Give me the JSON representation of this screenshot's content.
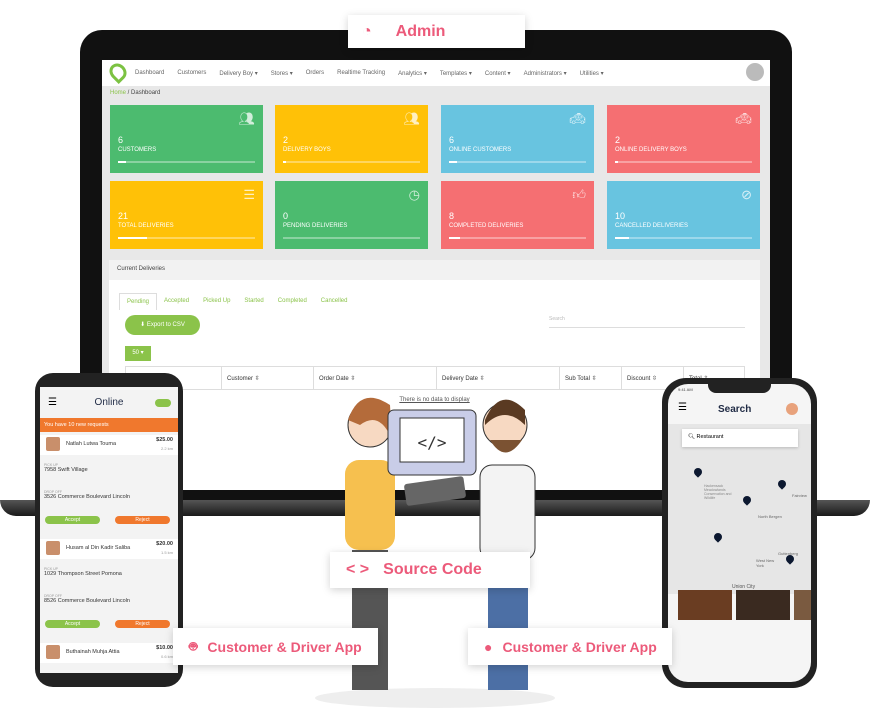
{
  "labels": {
    "admin": "Admin",
    "source_code": "Source Code",
    "android_app": "Customer & Driver App",
    "ios_app": "Customer & Driver App"
  },
  "nav": {
    "items": [
      "Dashboard",
      "Customers",
      "Delivery Boy ▾",
      "Stores ▾",
      "Orders",
      "Realtime Tracking",
      "Analytics ▾",
      "Templates ▾",
      "Content ▾",
      "Administrators ▾",
      "Utilities ▾"
    ]
  },
  "breadcrumb": {
    "home": "Home",
    "sep": " / ",
    "current": "Dashboard"
  },
  "cards": [
    {
      "value": "6",
      "label": "CUSTOMERS",
      "color": "#4cbb6f",
      "icon": "users-icon",
      "progress": 6
    },
    {
      "value": "2",
      "label": "DELIVERY BOYS",
      "color": "#ffc107",
      "icon": "users-icon",
      "progress": 2
    },
    {
      "value": "6",
      "label": "ONLINE CUSTOMERS",
      "color": "#68c4e0",
      "icon": "taxi-icon",
      "progress": 6
    },
    {
      "value": "2",
      "label": "ONLINE DELIVERY BOYS",
      "color": "#f56f72",
      "icon": "taxi-icon",
      "progress": 2
    },
    {
      "value": "21",
      "label": "TOTAL DELIVERIES",
      "color": "#ffc107",
      "icon": "list-icon",
      "progress": 21
    },
    {
      "value": "0",
      "label": "PENDING DELIVERIES",
      "color": "#4cbb6f",
      "icon": "clock-icon",
      "progress": 0
    },
    {
      "value": "8",
      "label": "COMPLETED DELIVERIES",
      "color": "#f56f72",
      "icon": "thumbs-up-icon",
      "progress": 8
    },
    {
      "value": "10",
      "label": "CANCELLED DELIVERIES",
      "color": "#68c4e0",
      "icon": "ban-icon",
      "progress": 10
    }
  ],
  "deliveries": {
    "title": "Current Deliveries",
    "tabs": [
      "Pending",
      "Accepted",
      "Picked Up",
      "Started",
      "Completed",
      "Cancelled"
    ],
    "export": "⬇ Export to CSV",
    "search_placeholder": "Search",
    "page_size": "50 ▾",
    "columns": [
      "",
      "Customer ⇳",
      "Order Date ⇳",
      "Delivery Date ⇳",
      "Sub Total ⇳",
      "Discount ⇳",
      "Total ⇳"
    ],
    "empty": "There is no data to display"
  },
  "driver_app": {
    "title": "Online",
    "banner": "You have 10 new requests",
    "requests": [
      {
        "name": "Natlah Lutwa Touma",
        "price": "$25.00",
        "dist": "2.2 km",
        "pickup_label": "PICK UP",
        "pickup": "7958 Swift Village",
        "dropoff_label": "DROP OFF",
        "dropoff": "3526 Commerce Boulevard Lincoln",
        "accept": "Accept",
        "reject": "Reject"
      },
      {
        "name": "Husam al Din Kadir Saliba",
        "price": "$20.00",
        "dist": "1.5 km",
        "pickup_label": "PICK UP",
        "pickup": "1029 Thompson Street Pomona",
        "dropoff_label": "DROP OFF",
        "dropoff": "8526 Commerce Boulevard Lincoln",
        "accept": "Accept",
        "reject": "Reject"
      },
      {
        "name": "Buthainah Muhja Attia",
        "price": "$10.00",
        "dist": "0.6 km"
      }
    ]
  },
  "customer_app": {
    "time": "9:41 AM",
    "title": "Search",
    "search_value": "Restaurant",
    "map_labels": [
      "Hackensack Meadowlands Conservation and Wildlife",
      "North Bergen",
      "Fairview",
      "Guttenberg",
      "West New York",
      "Union City"
    ]
  },
  "illustration": {
    "code_glyph": "</>"
  }
}
